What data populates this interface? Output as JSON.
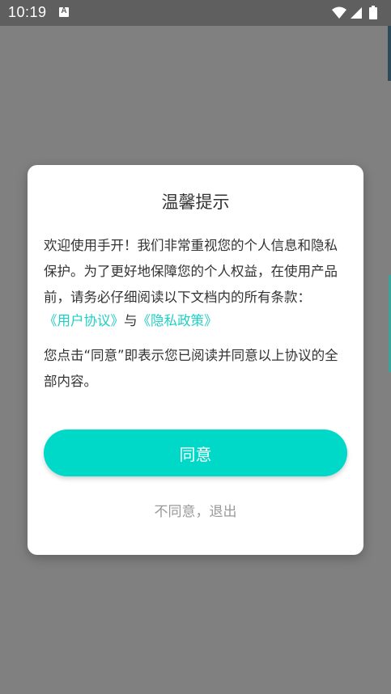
{
  "status_bar": {
    "time": "10:19",
    "notification_icon": "a-letter-icon",
    "wifi_icon": "wifi-icon",
    "signal_icon": "signal-icon",
    "battery_icon": "battery-icon"
  },
  "dialog": {
    "title": "温馨提示",
    "intro": "欢迎使用手开！我们非常重视您的个人信息和隐私保护。为了更好地保障您的个人权益，在使用产品前，请务必仔细阅读以下文档内的所有条款：",
    "user_agreement_link": "《用户协议》",
    "link_separator": "与",
    "privacy_policy_link": "《隐私政策》",
    "notice": "您点击“同意”即表示您已阅读并同意以上协议的全部内容。",
    "agree_label": "同意",
    "disagree_label": "不同意，退出"
  },
  "colors": {
    "accent": "#00d9c8",
    "link": "#1fcfc3",
    "overlay": "#808080"
  }
}
